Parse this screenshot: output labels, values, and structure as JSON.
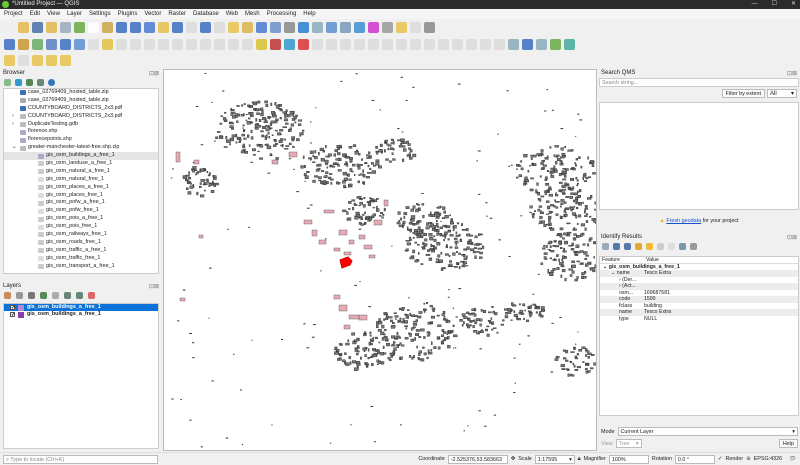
{
  "window": {
    "title": "*Untitled Project — QGIS",
    "controls": [
      "—",
      "☐",
      "✕"
    ]
  },
  "menu": [
    "Project",
    "Edit",
    "View",
    "Layer",
    "Settings",
    "Plugins",
    "Vector",
    "Raster",
    "Database",
    "Web",
    "Mesh",
    "Processing",
    "Help"
  ],
  "browser": {
    "title": "Browser",
    "items": [
      {
        "label": "case_02769409_hosted_table.zip",
        "icon": "#3d6db5",
        "indent": 1
      },
      {
        "label": "case_02769409_hosted_table.zip",
        "icon": "#aaa",
        "indent": 1
      },
      {
        "label": "COUNTYBOARD_DISTRICTS_2x3.pdf",
        "icon": "#3d6db5",
        "indent": 1
      },
      {
        "label": "COUNTYBOARD_DISTRICTS_2x3.pdf",
        "icon": "#bbb",
        "indent": 1,
        "arrow": "›"
      },
      {
        "label": "DuplicateTesting.gdb",
        "icon": "#bbb",
        "indent": 1,
        "arrow": "›"
      },
      {
        "label": "florence.shp",
        "icon": "#aac",
        "indent": 1
      },
      {
        "label": "florencepoints.shp",
        "icon": "#aac",
        "indent": 1
      },
      {
        "label": "greater-manchester-latest-free.shp.zip",
        "icon": "#bbb",
        "indent": 1,
        "arrow": "⌄"
      },
      {
        "label": "gis_osm_buildings_a_free_1",
        "icon": "#aac",
        "indent": 2,
        "selected": true
      },
      {
        "label": "gis_osm_landuse_a_free_1",
        "icon": "#ccc",
        "indent": 2
      },
      {
        "label": "gis_osm_natural_a_free_1",
        "icon": "#ccc",
        "indent": 2
      },
      {
        "label": "gis_osm_natural_free_1",
        "icon": "#ddd",
        "indent": 2
      },
      {
        "label": "gis_osm_places_a_free_1",
        "icon": "#ccc",
        "indent": 2
      },
      {
        "label": "gis_osm_places_free_1",
        "icon": "#ddd",
        "indent": 2
      },
      {
        "label": "gis_osm_pofw_a_free_1",
        "icon": "#ccc",
        "indent": 2
      },
      {
        "label": "gis_osm_pofw_free_1",
        "icon": "#ddd",
        "indent": 2
      },
      {
        "label": "gis_osm_pois_a_free_1",
        "icon": "#ccc",
        "indent": 2
      },
      {
        "label": "gis_osm_pois_free_1",
        "icon": "#ddd",
        "indent": 2
      },
      {
        "label": "gis_osm_railways_free_1",
        "icon": "#ccc",
        "indent": 2
      },
      {
        "label": "gis_osm_roads_free_1",
        "icon": "#ccc",
        "indent": 2
      },
      {
        "label": "gis_osm_traffic_a_free_1",
        "icon": "#ccc",
        "indent": 2
      },
      {
        "label": "gis_osm_traffic_free_1",
        "icon": "#ddd",
        "indent": 2
      },
      {
        "label": "gis_osm_transport_a_free_1",
        "icon": "#ccc",
        "indent": 2
      }
    ]
  },
  "layers": {
    "title": "Layers",
    "items": [
      {
        "label": "gis_osm_buildings_a_free_1",
        "color": "#b48ad0",
        "selected": true
      },
      {
        "label": "gis_osm_buildings_a_free_1",
        "color": "#8a3fa8",
        "selected": false
      }
    ]
  },
  "qms": {
    "title": "Search QMS",
    "placeholder": "Search string...",
    "filter_button": "Filter by extent",
    "filter_value": "All"
  },
  "geodata": {
    "link": "Fresh geodata",
    "suffix": " for your project"
  },
  "identify": {
    "title": "Identify Results",
    "headers": [
      "Feature",
      "Value"
    ],
    "rows": [
      {
        "feature": "gis_osm_buildings_a_free_1",
        "value": "",
        "level": 0,
        "bold": true,
        "arrow": "⌄"
      },
      {
        "feature": "name",
        "value": "Tesco Extra",
        "level": 1,
        "arrow": "⌄"
      },
      {
        "feature": "(Der...",
        "value": "",
        "level": 2,
        "arrow": "›"
      },
      {
        "feature": "(Act...",
        "value": "",
        "level": 2,
        "arrow": "›"
      },
      {
        "feature": "osm...",
        "value": "169687681",
        "level": 2
      },
      {
        "feature": "code",
        "value": "1500",
        "level": 2
      },
      {
        "feature": "fclass",
        "value": "building",
        "level": 2
      },
      {
        "feature": "name",
        "value": "Tesco Extra",
        "level": 2
      },
      {
        "feature": "type",
        "value": "NULL",
        "level": 2
      }
    ],
    "mode_label": "Mode",
    "mode_value": "Current Layer",
    "view_label": "View",
    "view_value": "Tree",
    "help": "Help"
  },
  "status": {
    "locate_placeholder": "Type to locate (Ctrl+K)",
    "coordinate_label": "Coordinate",
    "coordinate": "-2.525376,53.583663",
    "scale_label": "Scale",
    "scale": "1:17595",
    "magnifier_label": "Magnifier",
    "magnifier": "100%",
    "rotation_label": "Rotation",
    "rotation": "0.0 °",
    "render_label": "Render",
    "crs": "EPSG:4326"
  }
}
